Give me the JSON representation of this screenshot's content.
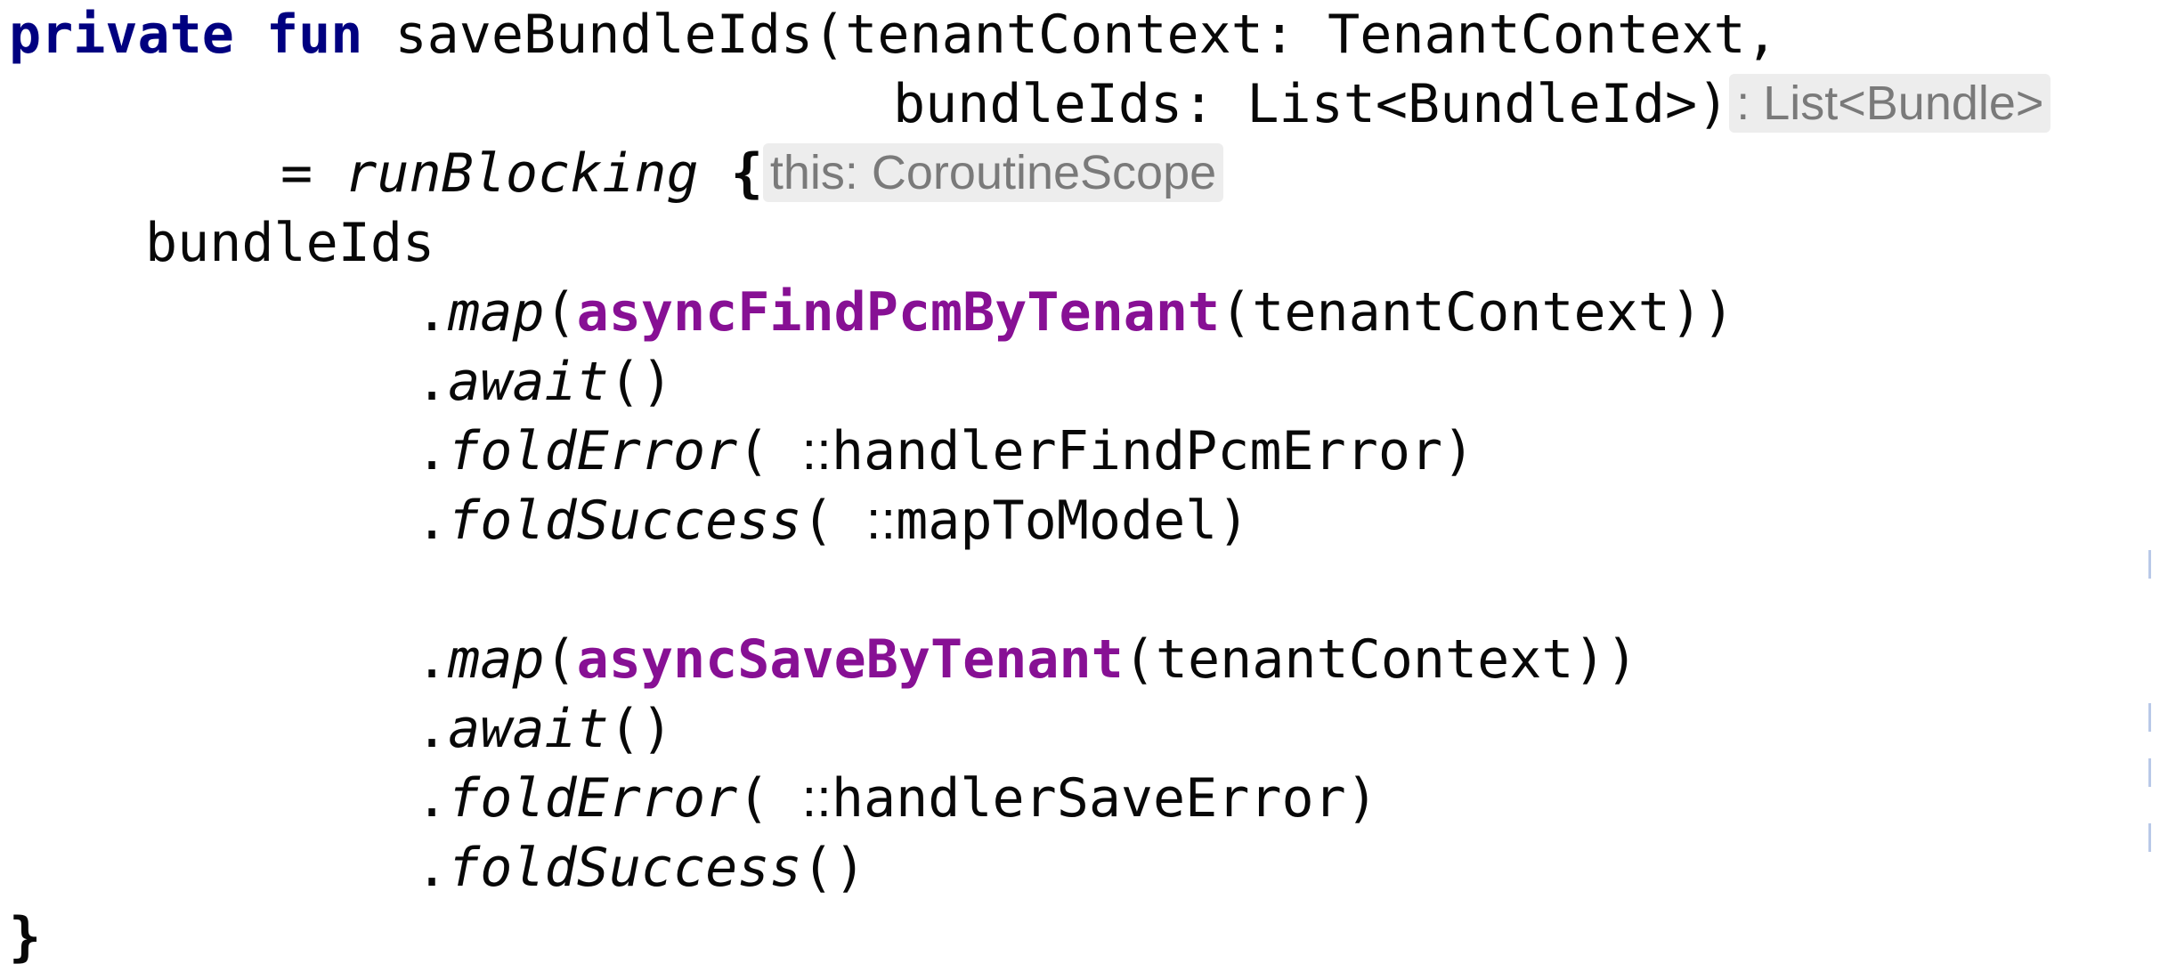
{
  "code": {
    "line1": {
      "kw_private": "private",
      "kw_fun": "fun",
      "signature": "saveBundleIds(tenantContext: TenantContext,"
    },
    "line2": {
      "text": "bundleIds: List<BundleId>)",
      "hint": ": List<Bundle>"
    },
    "line3": {
      "eq": "= ",
      "call": "runBlocking",
      "brace": " {",
      "hint": "this: CoroutineScope"
    },
    "line4": {
      "text": "bundleIds"
    },
    "line5": {
      "dot": ".",
      "method": "map",
      "open": "(",
      "func": "asyncFindPcmByTenant",
      "rest": "(tenantContext))"
    },
    "line6": {
      "dot": ".",
      "method": "await",
      "rest": "()"
    },
    "line7": {
      "dot": ".",
      "method": "foldError",
      "open": "( ",
      "sep": "::",
      "rest": "handlerFindPcmError)"
    },
    "line8": {
      "dot": ".",
      "method": "foldSuccess",
      "open": "( ",
      "sep": "::",
      "rest": "mapToModel)"
    },
    "line10": {
      "dot": ".",
      "method": "map",
      "open": "(",
      "func": "asyncSaveByTenant",
      "rest": "(tenantContext))"
    },
    "line11": {
      "dot": ".",
      "method": "await",
      "rest": "()"
    },
    "line12": {
      "dot": ".",
      "method": "foldError",
      "open": "( ",
      "sep": "::",
      "rest": "handlerSaveError)"
    },
    "line13": {
      "dot": ".",
      "method": "foldSuccess",
      "rest": "()"
    },
    "line14": {
      "brace": "}"
    }
  },
  "colors": {
    "keyword": "#000080",
    "function_ref": "#871094",
    "hint_bg": "#ededed",
    "hint_text": "#7a7a7a",
    "gutter_mark": "#b9c9e8"
  }
}
